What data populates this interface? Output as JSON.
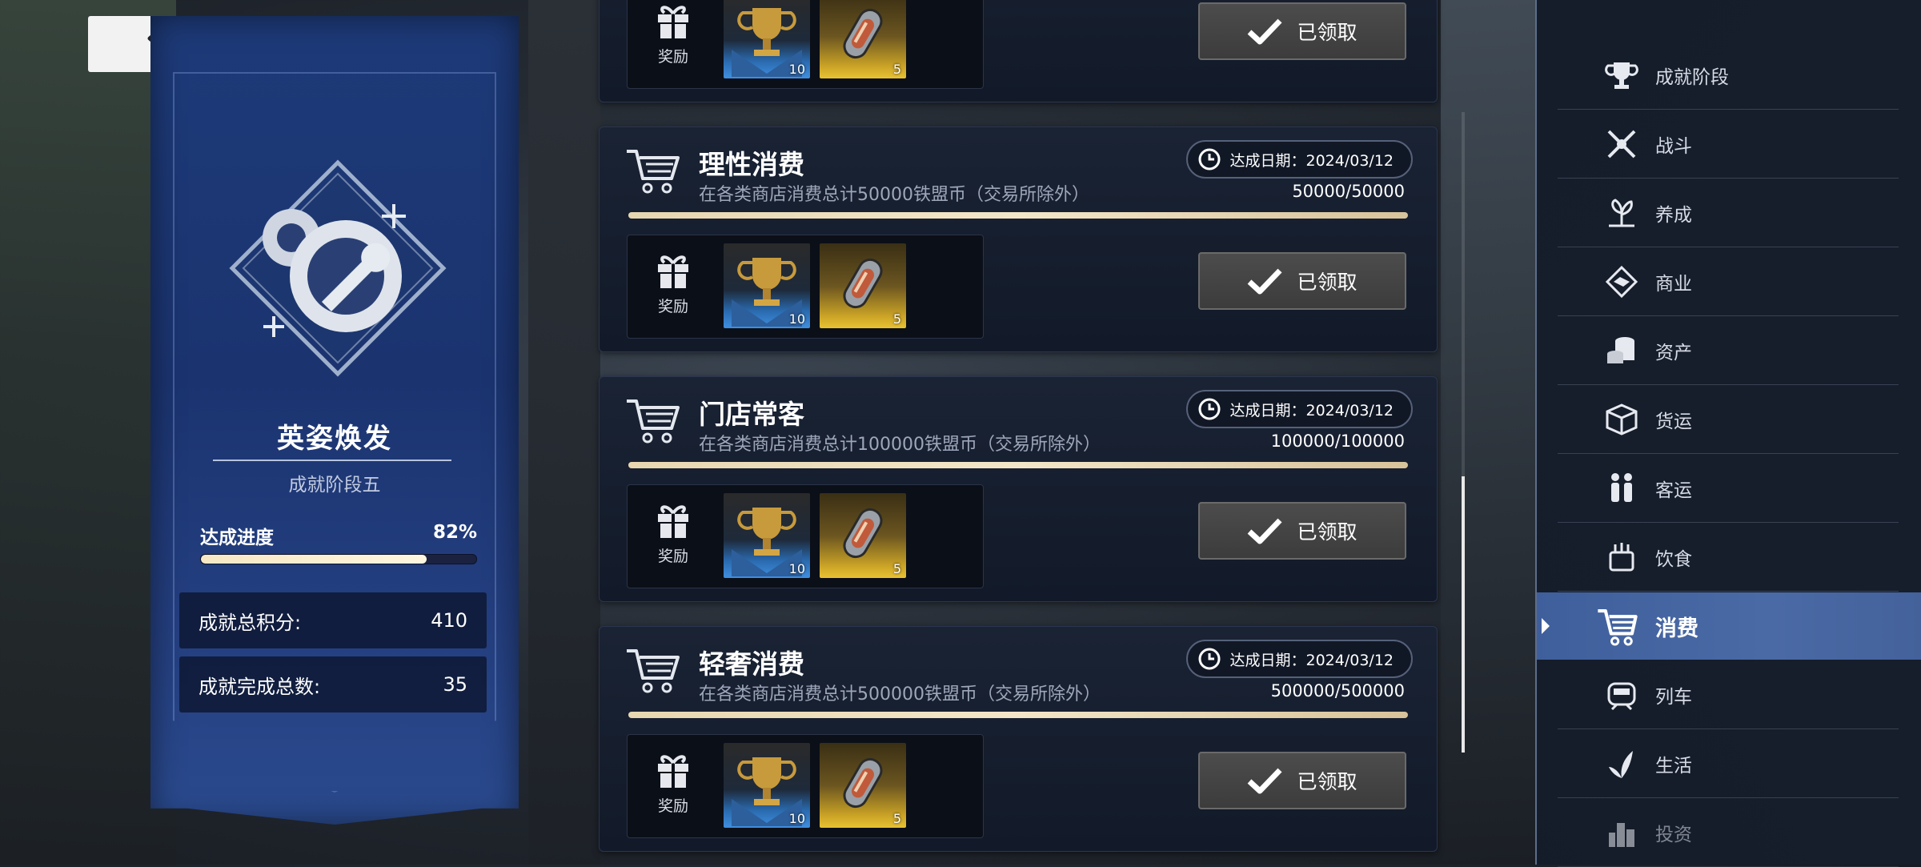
{
  "header": {
    "back_icon": "back-arrow-icon",
    "train_icon": "train-icon"
  },
  "banner": {
    "title": "英姿焕发",
    "stage": "成就阶段五",
    "progress_label": "达成进度",
    "progress_value": "82%",
    "progress_fraction": 0.82,
    "stats": [
      {
        "label": "成就总积分:",
        "value": "410"
      },
      {
        "label": "成就完成总数:",
        "value": "35"
      }
    ]
  },
  "cards": [
    {
      "title": "",
      "desc": "",
      "date": "",
      "count": "",
      "reward_label": "奖励",
      "qty_trophy": "10",
      "qty_pill": "5",
      "claim": "已领取"
    },
    {
      "title": "理性消费",
      "desc": "在各类商店消费总计50000铁盟币（交易所除外）",
      "date": "达成日期：2024/03/12",
      "count": "50000/50000",
      "reward_label": "奖励",
      "qty_trophy": "10",
      "qty_pill": "5",
      "claim": "已领取"
    },
    {
      "title": "门店常客",
      "desc": "在各类商店消费总计100000铁盟币（交易所除外）",
      "date": "达成日期：2024/03/12",
      "count": "100000/100000",
      "reward_label": "奖励",
      "qty_trophy": "10",
      "qty_pill": "5",
      "claim": "已领取"
    },
    {
      "title": "轻奢消费",
      "desc": "在各类商店消费总计500000铁盟币（交易所除外）",
      "date": "达成日期：2024/03/12",
      "count": "500000/500000",
      "reward_label": "奖励",
      "qty_trophy": "10",
      "qty_pill": "5",
      "claim": "已领取"
    }
  ],
  "nav": {
    "items": [
      {
        "label": "成就阶段",
        "icon": "trophy-icon"
      },
      {
        "label": "战斗",
        "icon": "crossed-swords-icon"
      },
      {
        "label": "养成",
        "icon": "growth-icon"
      },
      {
        "label": "商业",
        "icon": "handshake-icon"
      },
      {
        "label": "资产",
        "icon": "coins-icon"
      },
      {
        "label": "货运",
        "icon": "cargo-box-icon"
      },
      {
        "label": "客运",
        "icon": "passengers-icon"
      },
      {
        "label": "饮食",
        "icon": "food-icon"
      },
      {
        "label": "消费",
        "icon": "cart-icon"
      },
      {
        "label": "列车",
        "icon": "train-icon"
      },
      {
        "label": "生活",
        "icon": "leaf-icon"
      },
      {
        "label": "投资",
        "icon": "city-icon"
      }
    ],
    "active_label": "消费"
  },
  "colors": {
    "accent": "#4a6aa6",
    "banner": "#1d3a78",
    "progress": "#f7e8c4"
  }
}
